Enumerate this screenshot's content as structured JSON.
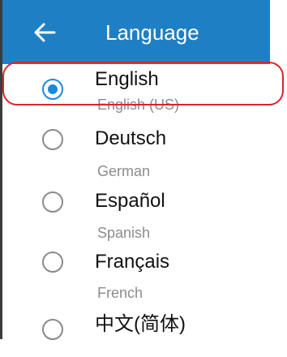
{
  "header": {
    "title": "Language",
    "background": "#1e7fc4",
    "back_icon": "arrow-left-icon"
  },
  "languages": [
    {
      "name": "English",
      "subtitle": "English (US)",
      "selected": true
    },
    {
      "name": "Deutsch",
      "subtitle": "German",
      "selected": false
    },
    {
      "name": "Español",
      "subtitle": "Spanish",
      "selected": false
    },
    {
      "name": "Français",
      "subtitle": "French",
      "selected": false
    },
    {
      "name": "中文(简体)",
      "subtitle": "",
      "selected": false
    }
  ],
  "colors": {
    "accent": "#1e88d8",
    "highlight": "#d9252d",
    "unchecked_radio": "#8a8a8a",
    "subtitle_text": "#8c8c8c"
  }
}
